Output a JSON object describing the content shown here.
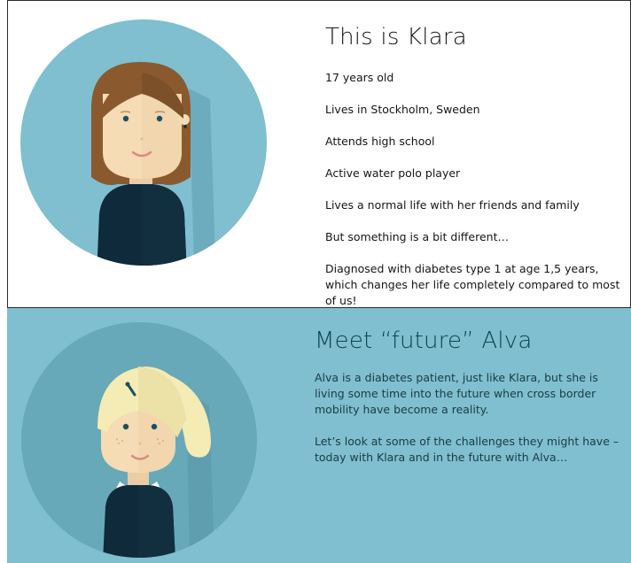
{
  "klara": {
    "title": "This is Klara",
    "facts": [
      "17 years old",
      "Lives in Stockholm, Sweden",
      "Attends high school",
      "Active water polo player",
      "Lives a normal life with her friends and family",
      "But something is a bit different…",
      "Diagnosed with diabetes type 1 at age 1,5 years, which changes her life completely compared to most of us!"
    ]
  },
  "alva": {
    "title": "Meet “future” Alva",
    "paragraphs": [
      "Alva is a diabetes patient, just like Klara, but she is living some time into the future when cross border mobility have become a reality.",
      "Let’s look at some of the challenges they might have – today with Klara and in the future with Alva…"
    ]
  },
  "colors": {
    "teal_background": "#7fbfcf",
    "avatar_circle_klara": "#7fbfcf",
    "avatar_circle_alva": "#68a9b9",
    "sweater": "#0f2a3a",
    "skin": "#f5dcb4",
    "brown_hair": "#8a5a2e",
    "blonde_hair": "#f4ecb4"
  }
}
